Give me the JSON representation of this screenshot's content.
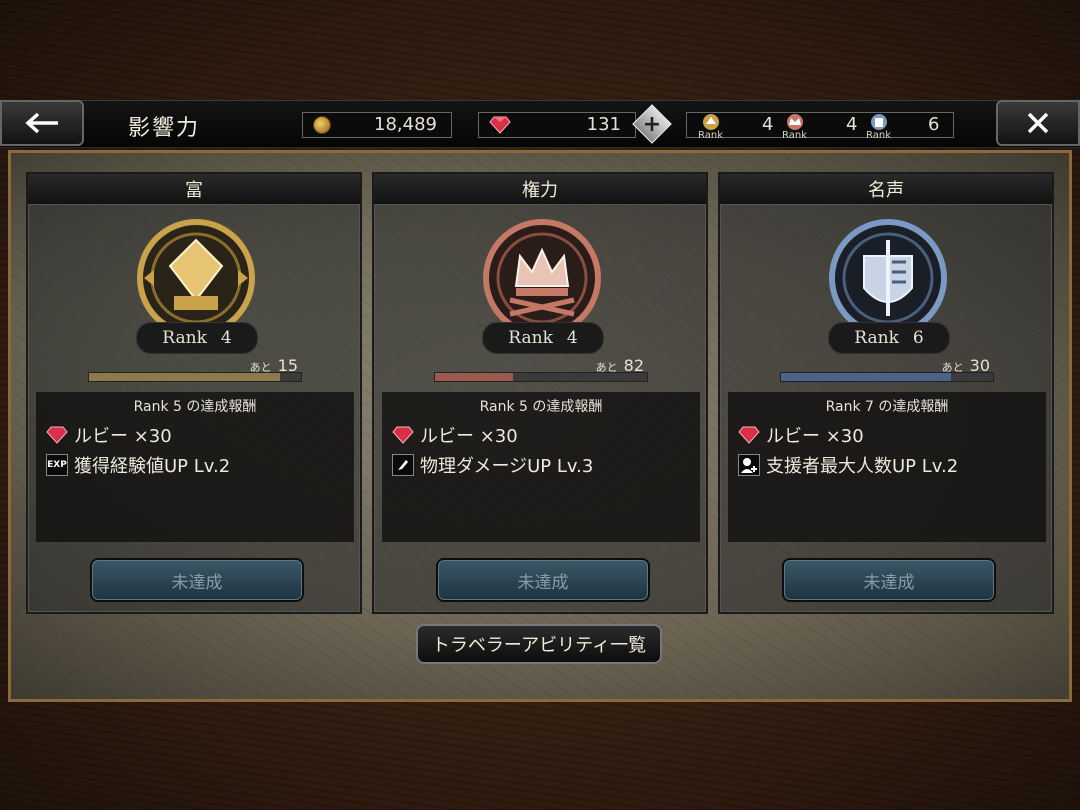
{
  "header": {
    "back_icon": "arrow-left-icon",
    "title": "影響力",
    "close_icon": "close-icon"
  },
  "resources": {
    "gold": "18,489",
    "ruby": "131",
    "plus": "+",
    "ranks": [
      {
        "label": "Rank",
        "value": "4",
        "icon": "wealth-rank-icon"
      },
      {
        "label": "Rank",
        "value": "4",
        "icon": "power-rank-icon"
      },
      {
        "label": "Rank",
        "value": "6",
        "icon": "fame-rank-icon"
      }
    ]
  },
  "panels": [
    {
      "title": "富",
      "rank_label": "Rank",
      "rank_value": "4",
      "remain_label": "あと",
      "remain_value": "15",
      "progress": 0.9,
      "bar_color": "#8c7a4e",
      "emblem_color": "#c9a24a",
      "reward_title": "Rank 5 の達成報酬",
      "rewards": [
        "ルビー ×30",
        "獲得経験値UP Lv.2"
      ],
      "reward_icons": [
        "ruby-icon",
        "exp-icon"
      ],
      "exp_text": "EXP",
      "button": "未達成"
    },
    {
      "title": "権力",
      "rank_label": "Rank",
      "rank_value": "4",
      "remain_label": "あと",
      "remain_value": "82",
      "progress": 0.37,
      "bar_color": "#9a5a50",
      "emblem_color": "#c47866",
      "reward_title": "Rank 5 の達成報酬",
      "rewards": [
        "ルビー ×30",
        "物理ダメージUP Lv.3"
      ],
      "reward_icons": [
        "ruby-icon",
        "physical-damage-icon"
      ],
      "button": "未達成"
    },
    {
      "title": "名声",
      "rank_label": "Rank",
      "rank_value": "6",
      "remain_label": "あと",
      "remain_value": "30",
      "progress": 0.8,
      "bar_color": "#4a6488",
      "emblem_color": "#7a9ac4",
      "reward_title": "Rank 7 の達成報酬",
      "rewards": [
        "ルビー ×30",
        "支援者最大人数UP Lv.2"
      ],
      "reward_icons": [
        "ruby-icon",
        "supporter-icon"
      ],
      "button": "未達成"
    }
  ],
  "footer": {
    "ability_button": "トラベラーアビリティ一覧"
  }
}
